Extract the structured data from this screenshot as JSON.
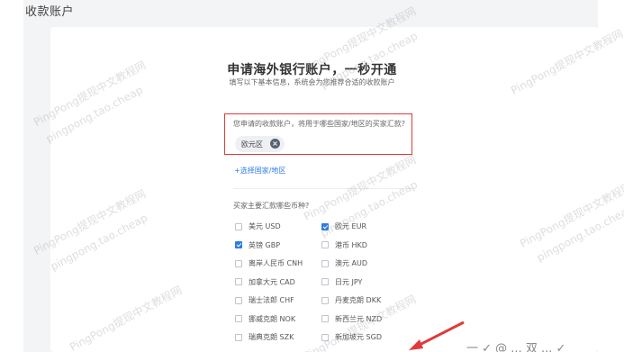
{
  "page": {
    "title": "收款账户"
  },
  "form": {
    "heading": "申请海外银行账户，一秒开通",
    "subheading": "填写以下基本信息，系统会为您推荐合适的收款账户",
    "region_question": "您申请的收款账户，将用于哪些国家/地区的买家汇款?",
    "selected_regions": [
      {
        "label": "欧元区"
      }
    ],
    "add_region_label": "+选择国家/地区",
    "currency_question": "买家主要汇款哪些币种?",
    "currencies": [
      {
        "label": "美元 USD",
        "checked": false
      },
      {
        "label": "欧元 EUR",
        "checked": true
      },
      {
        "label": "英镑 GBP",
        "checked": true
      },
      {
        "label": "港币 HKD",
        "checked": false
      },
      {
        "label": "离岸人民币 CNH",
        "checked": false
      },
      {
        "label": "澳元 AUD",
        "checked": false
      },
      {
        "label": "加拿大元 CAD",
        "checked": false
      },
      {
        "label": "日元 JPY",
        "checked": false
      },
      {
        "label": "瑞士法郎 CHF",
        "checked": false
      },
      {
        "label": "丹麦克朗 DKK",
        "checked": false
      },
      {
        "label": "挪威克朗 NOK",
        "checked": false
      },
      {
        "label": "新西兰元 NZD",
        "checked": false
      },
      {
        "label": "瑞典克朗 SZK",
        "checked": false
      },
      {
        "label": "新加坡元 SGD",
        "checked": false
      }
    ]
  },
  "watermark": {
    "line1": "PingPong提现中文教程网",
    "line2": "pingpong.tao.cheap"
  },
  "annotation_text": "一 ✓ @ ... 双 ... ✓"
}
